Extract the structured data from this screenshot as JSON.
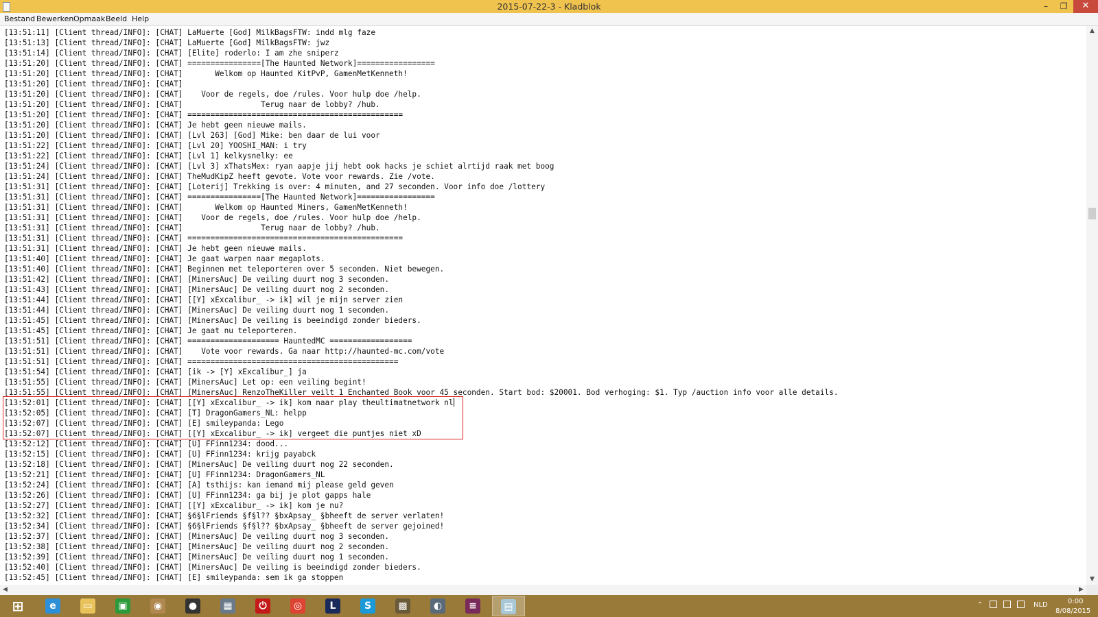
{
  "window": {
    "title": "2015-07-22-3 - Kladblok",
    "controls": {
      "minimize": "–",
      "maximize": "❐",
      "close": "✕"
    }
  },
  "menu": {
    "items": [
      "Bestand",
      "Bewerken",
      "Opmaak",
      "Beeld",
      "Help"
    ]
  },
  "editor": {
    "lines": [
      "[13:51:11] [Client thread/INFO]: [CHAT] LaMuerte [God] MilkBagsFTW: indd mlg faze",
      "[13:51:13] [Client thread/INFO]: [CHAT] LaMuerte [God] MilkBagsFTW: jwz",
      "[13:51:14] [Client thread/INFO]: [CHAT] [Elite] roderlo: I am zhe sniperz",
      "[13:51:20] [Client thread/INFO]: [CHAT] ================[The Haunted Network]=================",
      "[13:51:20] [Client thread/INFO]: [CHAT]       Welkom op Haunted KitPvP, GamenMetKenneth!",
      "[13:51:20] [Client thread/INFO]: [CHAT]",
      "[13:51:20] [Client thread/INFO]: [CHAT]    Voor de regels, doe /rules. Voor hulp doe /help.",
      "[13:51:20] [Client thread/INFO]: [CHAT]                 Terug naar de lobby? /hub.",
      "[13:51:20] [Client thread/INFO]: [CHAT] ===============================================",
      "[13:51:20] [Client thread/INFO]: [CHAT] Je hebt geen nieuwe mails.",
      "[13:51:20] [Client thread/INFO]: [CHAT] [Lvl 263] [God] Mike: ben daar de lui voor",
      "[13:51:22] [Client thread/INFO]: [CHAT] [Lvl 20] YOOSHI_MAN: i try",
      "[13:51:22] [Client thread/INFO]: [CHAT] [Lvl 1] kelkysnelky: ee",
      "[13:51:24] [Client thread/INFO]: [CHAT] [Lvl 3] xThatsMex: ryan aapje jij hebt ook hacks je schiet alrtijd raak met boog",
      "[13:51:24] [Client thread/INFO]: [CHAT] TheMudKipZ heeft gevote. Vote voor rewards. Zie /vote.",
      "[13:51:31] [Client thread/INFO]: [CHAT] [Loterij] Trekking is over: 4 minuten, and 27 seconden. Voor info doe /lottery",
      "[13:51:31] [Client thread/INFO]: [CHAT] ================[The Haunted Network]=================",
      "[13:51:31] [Client thread/INFO]: [CHAT]       Welkom op Haunted Miners, GamenMetKenneth!",
      "[13:51:31] [Client thread/INFO]: [CHAT]    Voor de regels, doe /rules. Voor hulp doe /help.",
      "[13:51:31] [Client thread/INFO]: [CHAT]                 Terug naar de lobby? /hub.",
      "[13:51:31] [Client thread/INFO]: [CHAT] ===============================================",
      "[13:51:31] [Client thread/INFO]: [CHAT] Je hebt geen nieuwe mails.",
      "[13:51:40] [Client thread/INFO]: [CHAT] Je gaat warpen naar megaplots.",
      "[13:51:40] [Client thread/INFO]: [CHAT] Beginnen met teleporteren over 5 seconden. Niet bewegen.",
      "[13:51:42] [Client thread/INFO]: [CHAT] [MinersAuc] De veiling duurt nog 3 seconden.",
      "[13:51:43] [Client thread/INFO]: [CHAT] [MinersAuc] De veiling duurt nog 2 seconden.",
      "[13:51:44] [Client thread/INFO]: [CHAT] [[Y] xExcalibur_ -> ik] wil je mijn server zien",
      "[13:51:44] [Client thread/INFO]: [CHAT] [MinersAuc] De veiling duurt nog 1 seconden.",
      "[13:51:45] [Client thread/INFO]: [CHAT] [MinersAuc] De veiling is beeindigd zonder bieders.",
      "[13:51:45] [Client thread/INFO]: [CHAT] Je gaat nu teleporteren.",
      "[13:51:51] [Client thread/INFO]: [CHAT] ==================== HauntedMC ==================",
      "[13:51:51] [Client thread/INFO]: [CHAT]    Vote voor rewards. Ga naar http://haunted-mc.com/vote",
      "[13:51:51] [Client thread/INFO]: [CHAT] ==============================================",
      "[13:51:54] [Client thread/INFO]: [CHAT] [ik -> [Y] xExcalibur_] ja",
      "[13:51:55] [Client thread/INFO]: [CHAT] [MinersAuc] Let op: een veiling begint!",
      "[13:51:55] [Client thread/INFO]: [CHAT] [MinersAuc] RenzoTheKiller veilt 1 Enchanted Book voor 45 seconden. Start bod: $20001. Bod verhoging: $1. Typ /auction info voor alle details.",
      "[13:52:01] [Client thread/INFO]: [CHAT] [[Y] xExcalibur_ -> ik] kom naar play theultimatnetwork nl",
      "[13:52:05] [Client thread/INFO]: [CHAT] [T] DragonGamers_NL: helpp",
      "[13:52:07] [Client thread/INFO]: [CHAT] [E] smileypanda: Lego",
      "[13:52:07] [Client thread/INFO]: [CHAT] [[Y] xExcalibur_ -> ik] vergeet die puntjes niet xD",
      "[13:52:12] [Client thread/INFO]: [CHAT] [U] FFinn1234: dood...",
      "[13:52:15] [Client thread/INFO]: [CHAT] [U] FFinn1234: krijg payabck",
      "[13:52:18] [Client thread/INFO]: [CHAT] [MinersAuc] De veiling duurt nog 22 seconden.",
      "[13:52:21] [Client thread/INFO]: [CHAT] [U] FFinn1234: DragonGamers_NL",
      "[13:52:24] [Client thread/INFO]: [CHAT] [A] tsthijs: kan iemand mij please geld geven",
      "[13:52:26] [Client thread/INFO]: [CHAT] [U] FFinn1234: ga bij je plot gapps hale",
      "[13:52:27] [Client thread/INFO]: [CHAT] [[Y] xExcalibur_ -> ik] kom je nu?",
      "[13:52:32] [Client thread/INFO]: [CHAT] §6§lFriends §f§l?? §bxApsay_ §bheeft de server verlaten!",
      "[13:52:34] [Client thread/INFO]: [CHAT] §6§lFriends §f§l?? §bxApsay_ §bheeft de server gejoined!",
      "[13:52:37] [Client thread/INFO]: [CHAT] [MinersAuc] De veiling duurt nog 3 seconden.",
      "[13:52:38] [Client thread/INFO]: [CHAT] [MinersAuc] De veiling duurt nog 2 seconden.",
      "[13:52:39] [Client thread/INFO]: [CHAT] [MinersAuc] De veiling duurt nog 1 seconden.",
      "[13:52:40] [Client thread/INFO]: [CHAT] [MinersAuc] De veiling is beeindigd zonder bieders.",
      "[13:52:45] [Client thread/INFO]: [CHAT] [E] smileypanda: sem ik ga stoppen"
    ]
  },
  "scrollbars": {
    "up": "▲",
    "down": "▼",
    "left": "◀",
    "right": "▶"
  },
  "taskbar": {
    "apps": [
      {
        "name": "start",
        "glyph": "⊞",
        "color": "#ffffff"
      },
      {
        "name": "internet-explorer",
        "glyph": "e",
        "color": "#2d8fd8"
      },
      {
        "name": "file-explorer",
        "glyph": "▭",
        "color": "#e8c25a"
      },
      {
        "name": "store",
        "glyph": "▣",
        "color": "#2a9a3a"
      },
      {
        "name": "app-5",
        "glyph": "◉",
        "color": "#b08850"
      },
      {
        "name": "app-6",
        "glyph": "●",
        "color": "#333333"
      },
      {
        "name": "app-7",
        "glyph": "▦",
        "color": "#6a7a8a"
      },
      {
        "name": "power",
        "glyph": "⏻",
        "color": "#c41a1a"
      },
      {
        "name": "chrome",
        "glyph": "◎",
        "color": "#dd4433"
      },
      {
        "name": "league-of-legends",
        "glyph": "L",
        "color": "#1a2a5a"
      },
      {
        "name": "skype",
        "glyph": "S",
        "color": "#1a9ad8"
      },
      {
        "name": "minecraft",
        "glyph": "▩",
        "color": "#6a5a3a"
      },
      {
        "name": "app-13",
        "glyph": "◐",
        "color": "#5a6a7a"
      },
      {
        "name": "winrar",
        "glyph": "≡",
        "color": "#7a2a5a"
      },
      {
        "name": "notepad",
        "glyph": "▤",
        "color": "#a8c8d8"
      }
    ],
    "tray": {
      "expand": "⌃",
      "language": "NLD",
      "time": "0:00",
      "date": "8/08/2015"
    }
  }
}
